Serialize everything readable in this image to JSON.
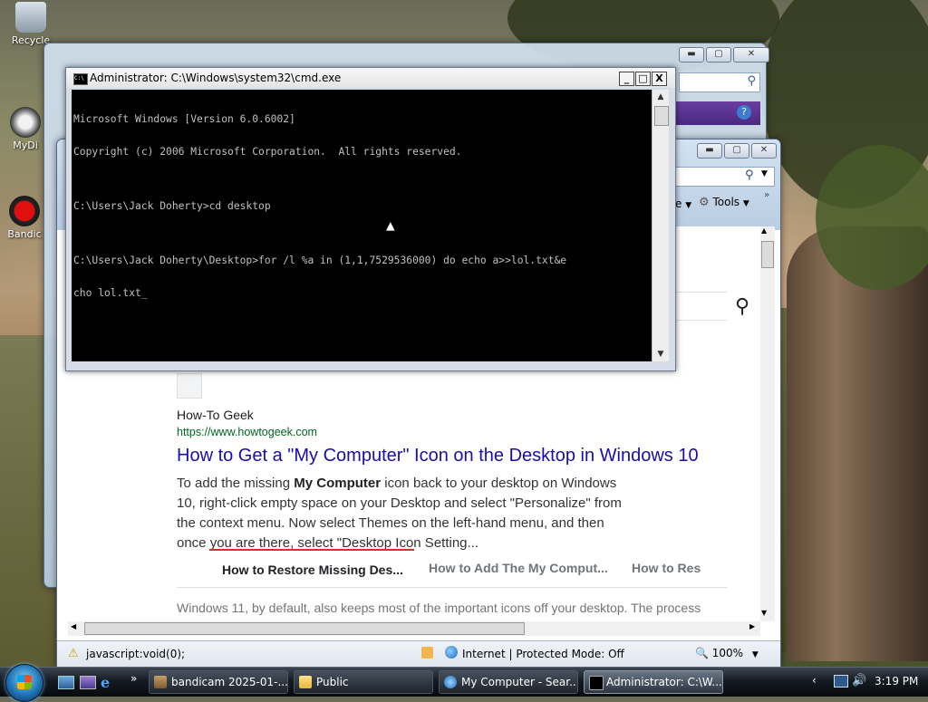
{
  "desktop": {
    "icons": [
      {
        "label": "Recycle",
        "icon": "recycle-bin-icon"
      },
      {
        "label": "MyDi",
        "icon": "my-documents-icon"
      },
      {
        "label": "Bandic",
        "icon": "bandicam-icon"
      }
    ]
  },
  "cmd": {
    "title": "Administrator: C:\\Windows\\system32\\cmd.exe",
    "lines": [
      "Microsoft Windows [Version 6.0.6002]",
      "Copyright (c) 2006 Microsoft Corporation.  All rights reserved.",
      "",
      "C:\\Users\\Jack Doherty>cd desktop",
      "",
      "C:\\Users\\Jack Doherty\\Desktop>for /l %a in (1,1,7529536000) do echo a>>lol.txt&e",
      "cho lol.txt_"
    ],
    "minimize": "_",
    "maximize": "□",
    "close": "X"
  },
  "ie": {
    "toolbar": {
      "page_partial": "e",
      "tools_label": "Tools"
    },
    "result": {
      "site_name": "How-To Geek",
      "site_url": "https://www.howtogeek.com",
      "title": "How to Get a \"My Computer\" Icon on the Desktop in Windows 10",
      "snippet_1": "To add the missing ",
      "snippet_bold": "My Computer",
      "snippet_2": " icon back to your desktop on Windows",
      "snippet_line2": "10, right-click empty space on your Desktop and select \"Personalize\" from",
      "snippet_line3": "the context menu. Now select Themes on the left-hand menu, and then",
      "snippet_line4": "once you are there, select \"Desktop Icon Setting..."
    },
    "related": [
      "How to Restore Missing Des...",
      "How to Add The My Comput...",
      "How to Res"
    ],
    "next_snippet": "Windows 11, by default, also keeps most of the important icons off your desktop. The process",
    "status": {
      "url": "javascript:void(0);",
      "zone": "Internet | Protected Mode: Off",
      "zoom": "100%"
    }
  },
  "taskbar": {
    "items": [
      {
        "label": "bandicam 2025-01-...",
        "icon": "bandicam-icon"
      },
      {
        "label": "Public",
        "icon": "folder-icon"
      },
      {
        "label": "My Computer - Sear...",
        "icon": "ie-icon"
      },
      {
        "label": "Administrator: C:\\W...",
        "icon": "cmd-icon"
      }
    ],
    "quicklaunch_more": "»",
    "clock": "3:19 PM"
  },
  "colors": {
    "link_blue": "#1a0dab",
    "url_green": "#006621",
    "console_bg": "#000000",
    "console_fg": "#c0c0c0",
    "underline_red": "#d93025"
  }
}
